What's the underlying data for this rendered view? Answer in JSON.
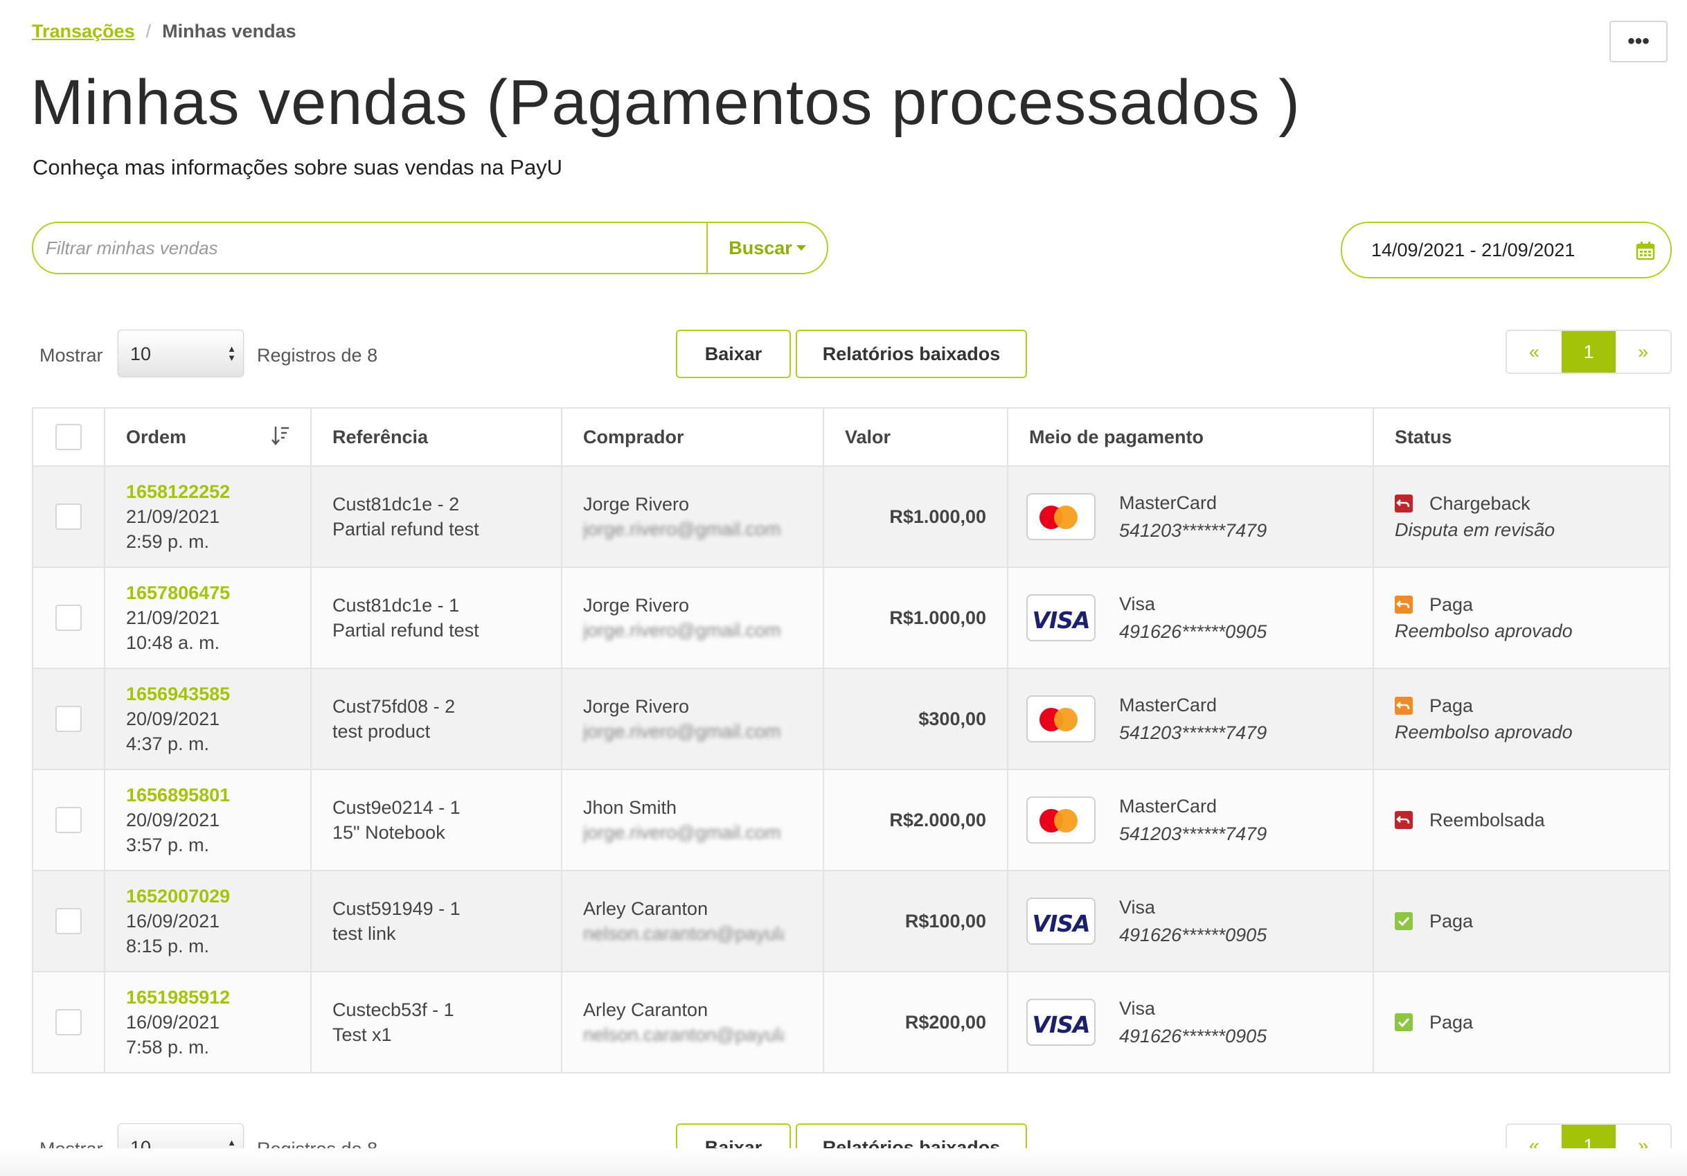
{
  "breadcrumb": {
    "parent": "Transações",
    "separator": "/",
    "current": "Minhas vendas"
  },
  "more_menu": {
    "label": "•••"
  },
  "page": {
    "title": "Minhas vendas (Pagamentos processados )",
    "subtitle": "Conheça mas informações sobre suas vendas na PayU"
  },
  "search": {
    "placeholder": "Filtrar minhas vendas",
    "value": "",
    "button_label": "Buscar"
  },
  "date_range": {
    "value": "14/09/2021 - 21/09/2021"
  },
  "toolbar": {
    "show_label": "Mostrar",
    "page_size": "10",
    "records_text": "Registros de 8",
    "download_label": "Baixar",
    "downloaded_reports_label": "Relatórios baixados"
  },
  "pagination": {
    "prev": "«",
    "current": "1",
    "next": "»"
  },
  "table": {
    "headers": {
      "ordem": "Ordem",
      "referencia": "Referência",
      "comprador": "Comprador",
      "valor": "Valor",
      "meio": "Meio de pagamento",
      "status": "Status"
    },
    "rows": [
      {
        "order_id": "1658122252",
        "date": "21/09/2021",
        "time": "2:59 p. m.",
        "ref_code": "Cust81dc1e - 2",
        "ref_desc": "Partial refund test",
        "buyer": "Jorge Rivero",
        "buyer_email": "jorge.rivero@gmail.com",
        "amount": "R$1.000,00",
        "card": "MasterCard",
        "card_number": "541203******7479",
        "status": "Chargeback",
        "status_detail": "Disputa em revisão",
        "status_color": "red"
      },
      {
        "order_id": "1657806475",
        "date": "21/09/2021",
        "time": "10:48 a. m.",
        "ref_code": "Cust81dc1e - 1",
        "ref_desc": "Partial refund test",
        "buyer": "Jorge Rivero",
        "buyer_email": "jorge.rivero@gmail.com",
        "amount": "R$1.000,00",
        "card": "Visa",
        "card_number": "491626******0905",
        "status": "Paga",
        "status_detail": "Reembolso aprovado",
        "status_color": "orange"
      },
      {
        "order_id": "1656943585",
        "date": "20/09/2021",
        "time": "4:37 p. m.",
        "ref_code": "Cust75fd08 - 2",
        "ref_desc": "test product",
        "buyer": "Jorge Rivero",
        "buyer_email": "jorge.rivero@gmail.com",
        "amount": "$300,00",
        "card": "MasterCard",
        "card_number": "541203******7479",
        "status": "Paga",
        "status_detail": "Reembolso aprovado",
        "status_color": "orange"
      },
      {
        "order_id": "1656895801",
        "date": "20/09/2021",
        "time": "3:57 p. m.",
        "ref_code": "Cust9e0214 - 1",
        "ref_desc": "15\" Notebook",
        "buyer": "Jhon Smith",
        "buyer_email": "jorge.rivero@gmail.com",
        "amount": "R$2.000,00",
        "card": "MasterCard",
        "card_number": "541203******7479",
        "status": "Reembolsada",
        "status_detail": "",
        "status_color": "red"
      },
      {
        "order_id": "1652007029",
        "date": "16/09/2021",
        "time": "8:15 p. m.",
        "ref_code": "Cust591949 - 1",
        "ref_desc": "test link",
        "buyer": "Arley Caranton",
        "buyer_email": "nelson.caranton@payulatam.com",
        "amount": "R$100,00",
        "card": "Visa",
        "card_number": "491626******0905",
        "status": "Paga",
        "status_detail": "",
        "status_color": "green"
      },
      {
        "order_id": "1651985912",
        "date": "16/09/2021",
        "time": "7:58 p. m.",
        "ref_code": "Custecb53f - 1",
        "ref_desc": "Test x1",
        "buyer": "Arley Caranton",
        "buyer_email": "nelson.caranton@payulatam.com",
        "amount": "R$200,00",
        "card": "Visa",
        "card_number": "491626******0905",
        "status": "Paga",
        "status_detail": "",
        "status_color": "green"
      }
    ]
  },
  "colors": {
    "accent": "#a6c307",
    "chargeback": "#c0252b",
    "refund": "#f08a24",
    "paid": "#8dc63f"
  }
}
